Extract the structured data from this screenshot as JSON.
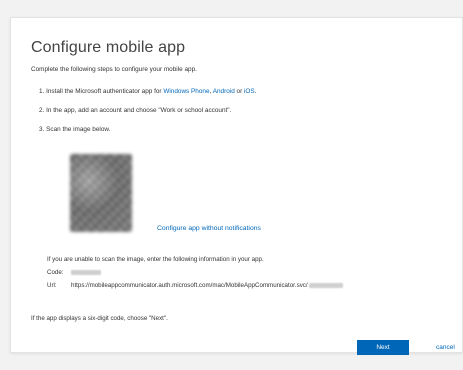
{
  "page": {
    "title": "Configure mobile app",
    "intro": "Complete the following steps to configure your mobile app."
  },
  "steps": {
    "step1": {
      "prefix": "1. Install the Microsoft authenticator app for ",
      "link_windows": "Windows Phone",
      "sep1": ", ",
      "link_android": "Android",
      "sep2": " or ",
      "link_ios": "iOS",
      "suffix": "."
    },
    "step2": "2. In the app, add an account and choose \"Work or school account\".",
    "step3": "3. Scan the image below."
  },
  "qr": {
    "configure_without_notifications": "Configure app without notifications"
  },
  "manual": {
    "instructions": "If you are unable to scan the image, enter the following information in your app.",
    "code_label": "Code:",
    "url_label": "Url:",
    "url_value": "https://mobileappcommunicator.auth.microsoft.com/mac/MobileAppCommunicator.svc/"
  },
  "six_digit_note": "If the app displays a six-digit code, choose \"Next\".",
  "actions": {
    "next_label": "Next",
    "cancel_label": "cancel"
  }
}
